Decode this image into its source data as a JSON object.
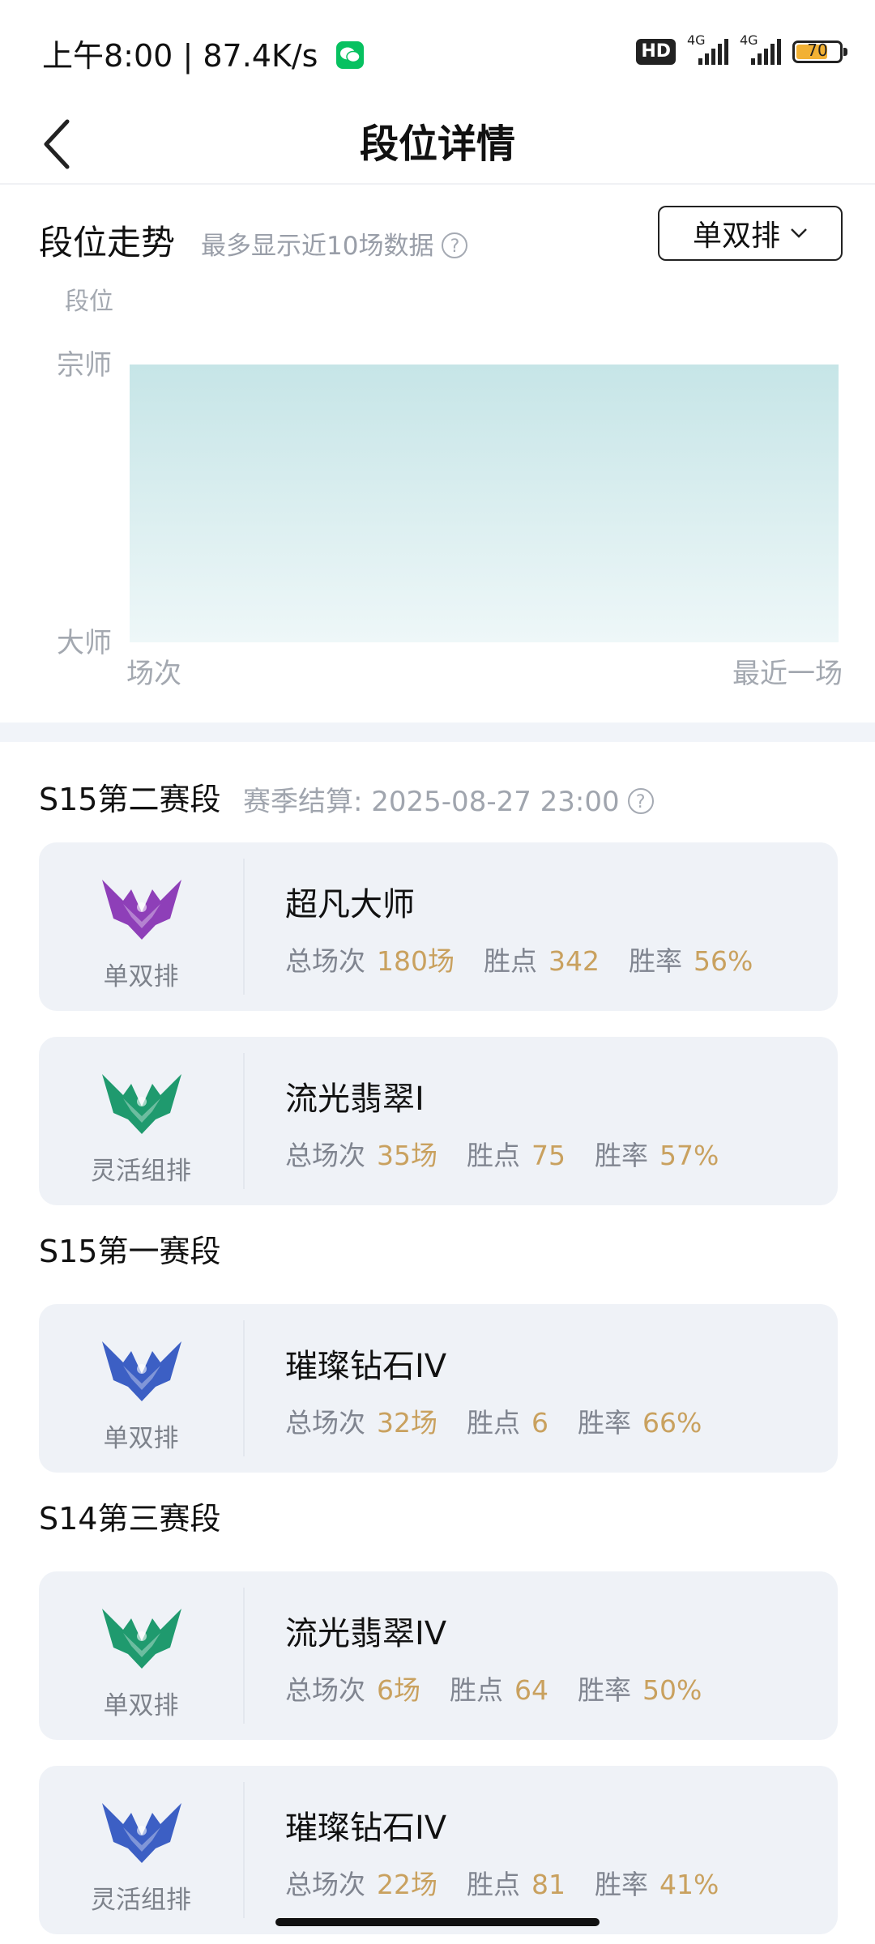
{
  "status_bar": {
    "time": "上午8:00",
    "separator": "|",
    "speed": "87.4K/s",
    "hd": "HD",
    "signal_label_1": "4G",
    "signal_label_2": "4G",
    "battery": "70"
  },
  "navbar": {
    "title": "段位详情"
  },
  "trend": {
    "title": "段位走势",
    "subtitle": "最多显示近10场数据",
    "help": "?",
    "queue_select": "单双排",
    "chart_data": {
      "type": "area",
      "ylabel": "段位",
      "y_tick_labels": [
        "宗师",
        "大师"
      ],
      "x_tick_labels": [
        "场次",
        "最近一场"
      ],
      "series": [
        {
          "values": [
            "宗师",
            "宗师"
          ]
        }
      ],
      "fill_color": "#c9e6e8"
    }
  },
  "seasons": [
    {
      "name": "S15第二赛段",
      "settlement_label": "赛季结算: 2025-08-27 23:00",
      "cards": [
        {
          "queue": "单双排",
          "rank": "超凡大师",
          "emblem": "master-emblem",
          "emblem_color": "#8e3fb8",
          "games_label": "总场次",
          "games": "180场",
          "lp_label": "胜点",
          "lp": "342",
          "wr_label": "胜率",
          "wr": "56%"
        },
        {
          "queue": "灵活组排",
          "rank": "流光翡翠I",
          "emblem": "emerald-emblem",
          "emblem_color": "#1f9a6e",
          "games_label": "总场次",
          "games": "35场",
          "lp_label": "胜点",
          "lp": "75",
          "wr_label": "胜率",
          "wr": "57%"
        }
      ]
    },
    {
      "name": "S15第一赛段",
      "cards": [
        {
          "queue": "单双排",
          "rank": "璀璨钻石IV",
          "emblem": "diamond-emblem",
          "emblem_color": "#3c5fc4",
          "games_label": "总场次",
          "games": "32场",
          "lp_label": "胜点",
          "lp": "6",
          "wr_label": "胜率",
          "wr": "66%"
        }
      ]
    },
    {
      "name": "S14第三赛段",
      "cards": [
        {
          "queue": "单双排",
          "rank": "流光翡翠IV",
          "emblem": "emerald-emblem",
          "emblem_color": "#1f9a6e",
          "games_label": "总场次",
          "games": "6场",
          "lp_label": "胜点",
          "lp": "64",
          "wr_label": "胜率",
          "wr": "50%"
        },
        {
          "queue": "灵活组排",
          "rank": "璀璨钻石IV",
          "emblem": "diamond-emblem",
          "emblem_color": "#3c5fc4",
          "games_label": "总场次",
          "games": "22场",
          "lp_label": "胜点",
          "lp": "81",
          "wr_label": "胜率",
          "wr": "41%"
        }
      ]
    }
  ]
}
